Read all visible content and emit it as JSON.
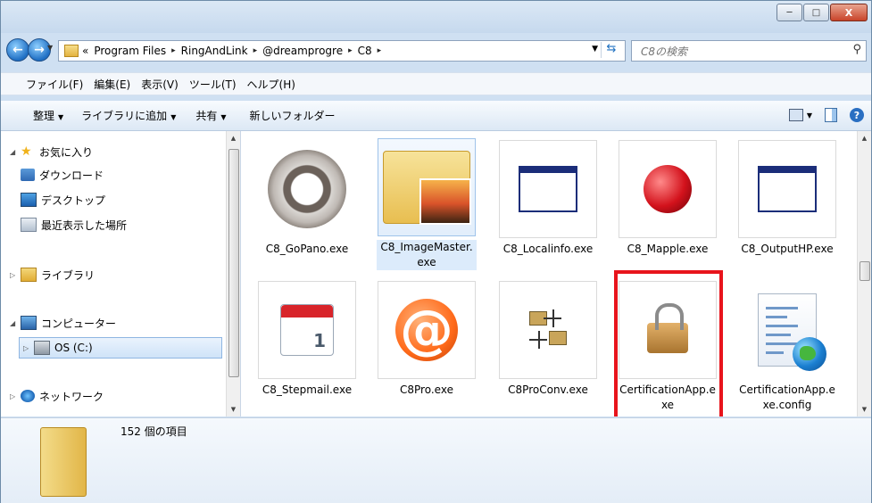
{
  "window": {
    "controls": {
      "minimize": "─",
      "maximize": "□",
      "close": "X"
    }
  },
  "address": {
    "overflow": "«",
    "crumbs": [
      "Program Files",
      "RingAndLink",
      "@dreamprogre",
      "C8"
    ],
    "separator": "▸",
    "search_placeholder": "C8の検索"
  },
  "menu": [
    "ファイル(F)",
    "編集(E)",
    "表示(V)",
    "ツール(T)",
    "ヘルプ(H)"
  ],
  "commands": [
    "整理",
    "ライブラリに追加",
    "共有",
    "新しいフォルダー"
  ],
  "nav_tree": {
    "favorites": "お気に入り",
    "downloads": "ダウンロード",
    "desktop": "デスクトップ",
    "recent": "最近表示した場所",
    "libraries": "ライブラリ",
    "computer": "コンピューター",
    "drive": "OS (C:)",
    "network": "ネットワーク"
  },
  "files": [
    "C8_GoPano.exe",
    "C8_ImageMaster.exe",
    "C8_Localinfo.exe",
    "C8_Mapple.exe",
    "C8_OutputHP.exe",
    "C8_Stepmail.exe",
    "C8Pro.exe",
    "C8ProConv.exe",
    "CertificationApp.exe",
    "CertificationApp.exe.config"
  ],
  "calendar_digit": "1",
  "status": {
    "count": "152 個の項目"
  },
  "colors": {
    "highlight": "#e8141c",
    "selection": "#dcebfb"
  }
}
